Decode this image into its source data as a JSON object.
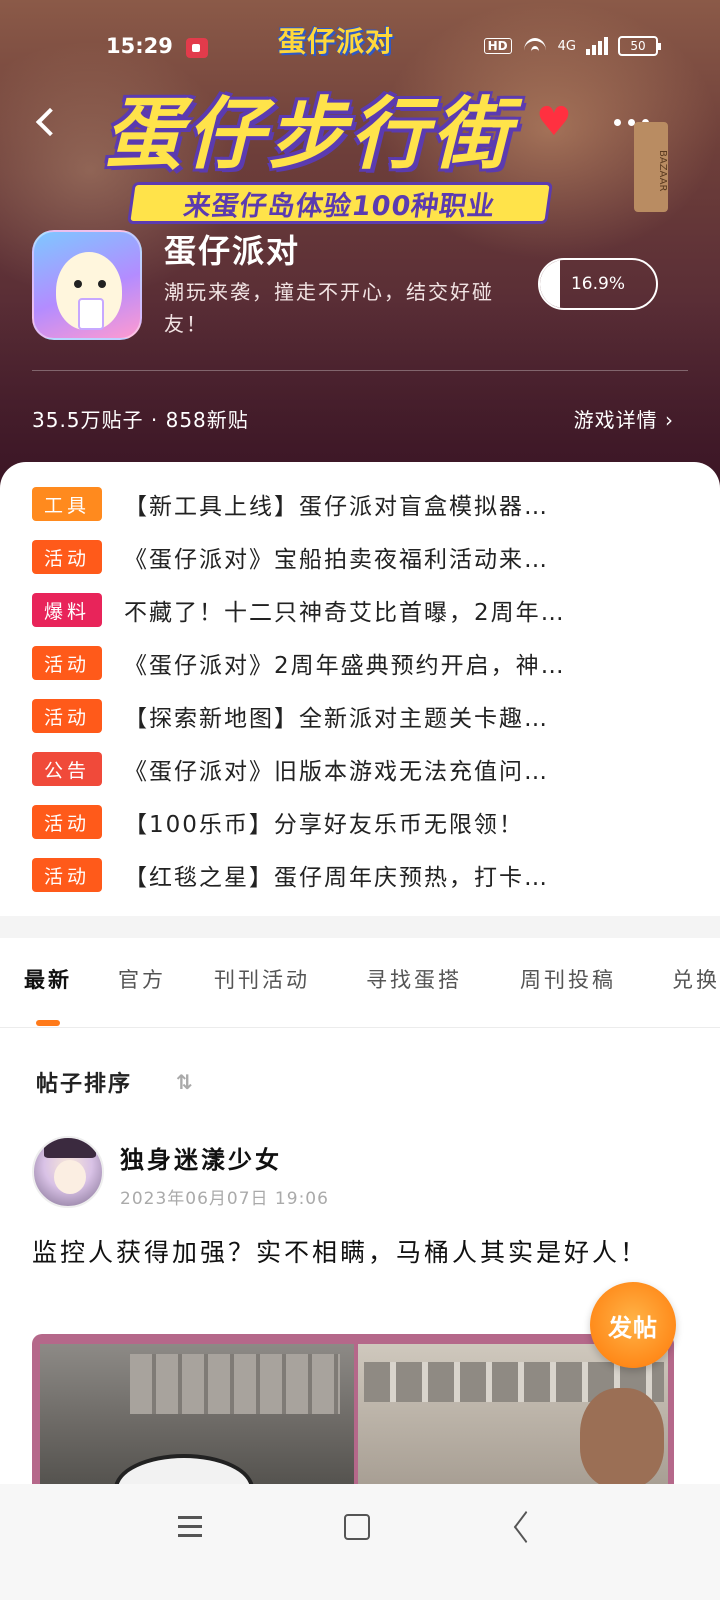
{
  "status": {
    "time": "15:29",
    "hd": "HD",
    "network": "4G",
    "battery": "50"
  },
  "banner": {
    "top_logo": "蛋仔派对",
    "title": "蛋仔步行街",
    "subtitle": "来蛋仔岛体验100种职业",
    "side_sign": "BAZAAR"
  },
  "game": {
    "name": "蛋仔派对",
    "description": "潮玩来袭，撞走不开心，结交好碰友！",
    "follow_progress": "16.9%",
    "follow_fraction": 0.169,
    "stats": "35.5万贴子 · 858新贴",
    "details_link": "游戏详情 ›"
  },
  "notices": [
    {
      "tag": "工具",
      "color": "#ff8a1e",
      "text": "【新工具上线】蛋仔派对盲盒模拟器…"
    },
    {
      "tag": "活动",
      "color": "#ff5a1a",
      "text": "《蛋仔派对》宝船拍卖夜福利活动来…"
    },
    {
      "tag": "爆料",
      "color": "#e8245a",
      "text": "不藏了！十二只神奇艾比首曝，2周年…"
    },
    {
      "tag": "活动",
      "color": "#ff5a1a",
      "text": "《蛋仔派对》2周年盛典预约开启，神…"
    },
    {
      "tag": "活动",
      "color": "#ff5a1a",
      "text": "【探索新地图】全新派对主题关卡趣…"
    },
    {
      "tag": "公告",
      "color": "#f04a3a",
      "text": "《蛋仔派对》旧版本游戏无法充值问…"
    },
    {
      "tag": "活动",
      "color": "#ff5a1a",
      "text": "【100乐币】分享好友乐币无限领！"
    },
    {
      "tag": "活动",
      "color": "#ff5a1a",
      "text": "【红毯之星】蛋仔周年庆预热，打卡…"
    }
  ],
  "tabs": [
    {
      "label": "最新",
      "active": true
    },
    {
      "label": "官方"
    },
    {
      "label": "刊刊活动"
    },
    {
      "label": "寻找蛋搭"
    },
    {
      "label": "周刊投稿"
    },
    {
      "label": "兑换"
    }
  ],
  "feed": {
    "sort_label": "帖子排序",
    "sort_icon": "⇅",
    "post": {
      "author": "独身迷漾少女",
      "time": "2023年06月07日 19:06",
      "title": "监控人获得加强？实不相瞒，马桶人其实是好人！"
    },
    "fab_label": "发帖"
  }
}
